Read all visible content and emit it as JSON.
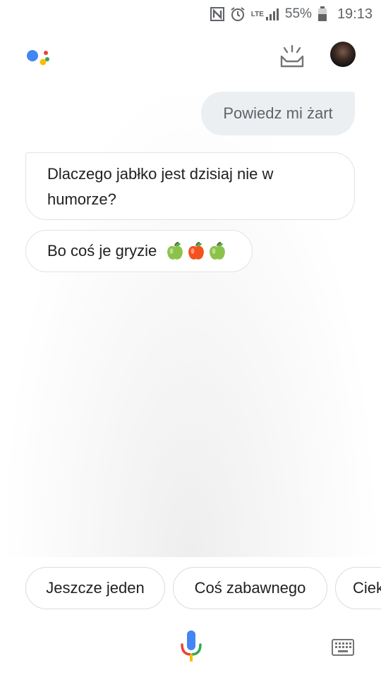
{
  "status_bar": {
    "nfc": "N",
    "network": "LTE",
    "battery_percent": "55%",
    "time": "19:13"
  },
  "header": {
    "logo_icon": "google-assistant-dots-icon",
    "updates_icon": "updates-tray-icon",
    "avatar_icon": "user-avatar"
  },
  "conversation": {
    "user_message": "Powiedz mi żart",
    "assistant_message_1": "Dlaczego jabłko jest dzisiaj nie w humorze?",
    "assistant_message_2": "Bo coś je gryzie",
    "emoji": [
      "green-apple-emoji",
      "red-apple-emoji",
      "green-apple-emoji"
    ]
  },
  "suggestions": [
    {
      "label": "Jeszcze jeden"
    },
    {
      "label": "Coś zabawnego"
    },
    {
      "label": "Ciek"
    }
  ],
  "bottom_bar": {
    "mic_icon": "microphone-icon",
    "keyboard_icon": "keyboard-icon"
  },
  "colors": {
    "user_bubble": "#eceff1",
    "google_blue": "#4285f4",
    "google_red": "#ea4335",
    "google_yellow": "#fbbc05",
    "google_green": "#34a853"
  }
}
